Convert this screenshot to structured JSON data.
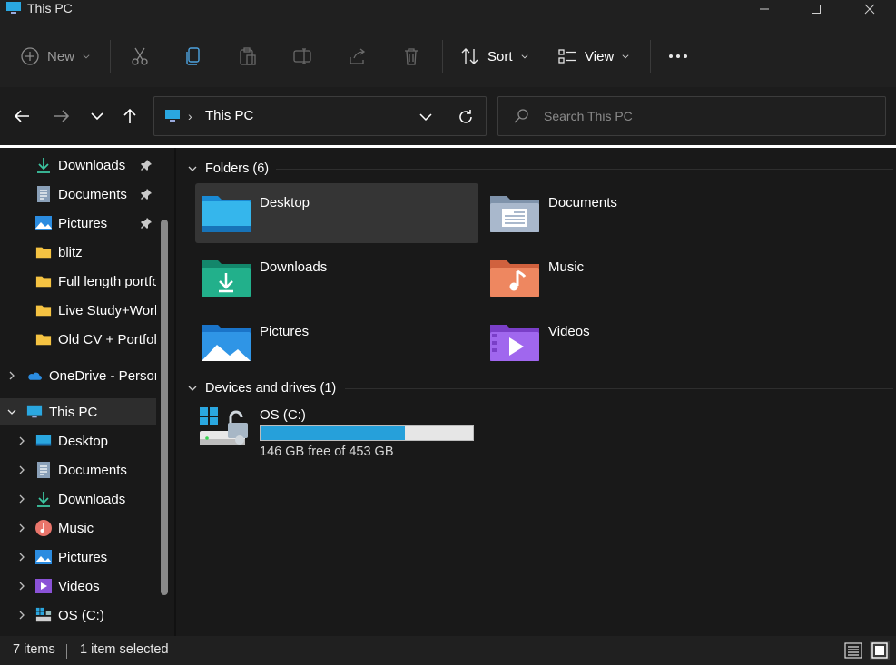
{
  "window": {
    "title": "This PC"
  },
  "toolbar": {
    "new_label": "New",
    "sort_label": "Sort",
    "view_label": "View"
  },
  "address": {
    "crumb": "This PC",
    "search_placeholder": "Search This PC"
  },
  "sidebar": {
    "quick_access": [
      {
        "label": "Downloads",
        "icon": "downloads-icon",
        "pinned": true
      },
      {
        "label": "Documents",
        "icon": "documents-icon",
        "pinned": true
      },
      {
        "label": "Pictures",
        "icon": "pictures-icon",
        "pinned": true
      },
      {
        "label": "blitz",
        "icon": "folder-icon"
      },
      {
        "label": "Full length portfolio",
        "icon": "folder-icon"
      },
      {
        "label": "Live Study+Work",
        "icon": "folder-icon"
      },
      {
        "label": "Old CV + Portfolio",
        "icon": "folder-icon"
      }
    ],
    "onedrive": {
      "label": "OneDrive - Personal",
      "icon": "onedrive-icon"
    },
    "thispc": {
      "label": "This PC",
      "icon": "pc-icon"
    },
    "thispc_children": [
      {
        "label": "Desktop",
        "icon": "desktop-icon"
      },
      {
        "label": "Documents",
        "icon": "documents-icon"
      },
      {
        "label": "Downloads",
        "icon": "downloads-icon"
      },
      {
        "label": "Music",
        "icon": "music-icon"
      },
      {
        "label": "Pictures",
        "icon": "pictures-icon"
      },
      {
        "label": "Videos",
        "icon": "videos-icon"
      },
      {
        "label": "OS (C:)",
        "icon": "drive-icon"
      }
    ]
  },
  "content": {
    "folders_header": "Folders (6)",
    "folders": [
      {
        "label": "Desktop",
        "icon": "desktop-folder-icon",
        "selected": true
      },
      {
        "label": "Documents",
        "icon": "documents-folder-icon"
      },
      {
        "label": "Downloads",
        "icon": "downloads-folder-icon"
      },
      {
        "label": "Music",
        "icon": "music-folder-icon"
      },
      {
        "label": "Pictures",
        "icon": "pictures-folder-icon"
      },
      {
        "label": "Videos",
        "icon": "videos-folder-icon"
      }
    ],
    "drives_header": "Devices and drives (1)",
    "drive": {
      "name": "OS (C:)",
      "free_text": "146 GB free of 453 GB",
      "used_fraction": 0.678
    }
  },
  "status": {
    "items": "7 items",
    "selected": "1 item selected"
  },
  "colors": {
    "accent": "#26a0da",
    "background": "#191919",
    "folder_yellow": "#f5c342"
  }
}
